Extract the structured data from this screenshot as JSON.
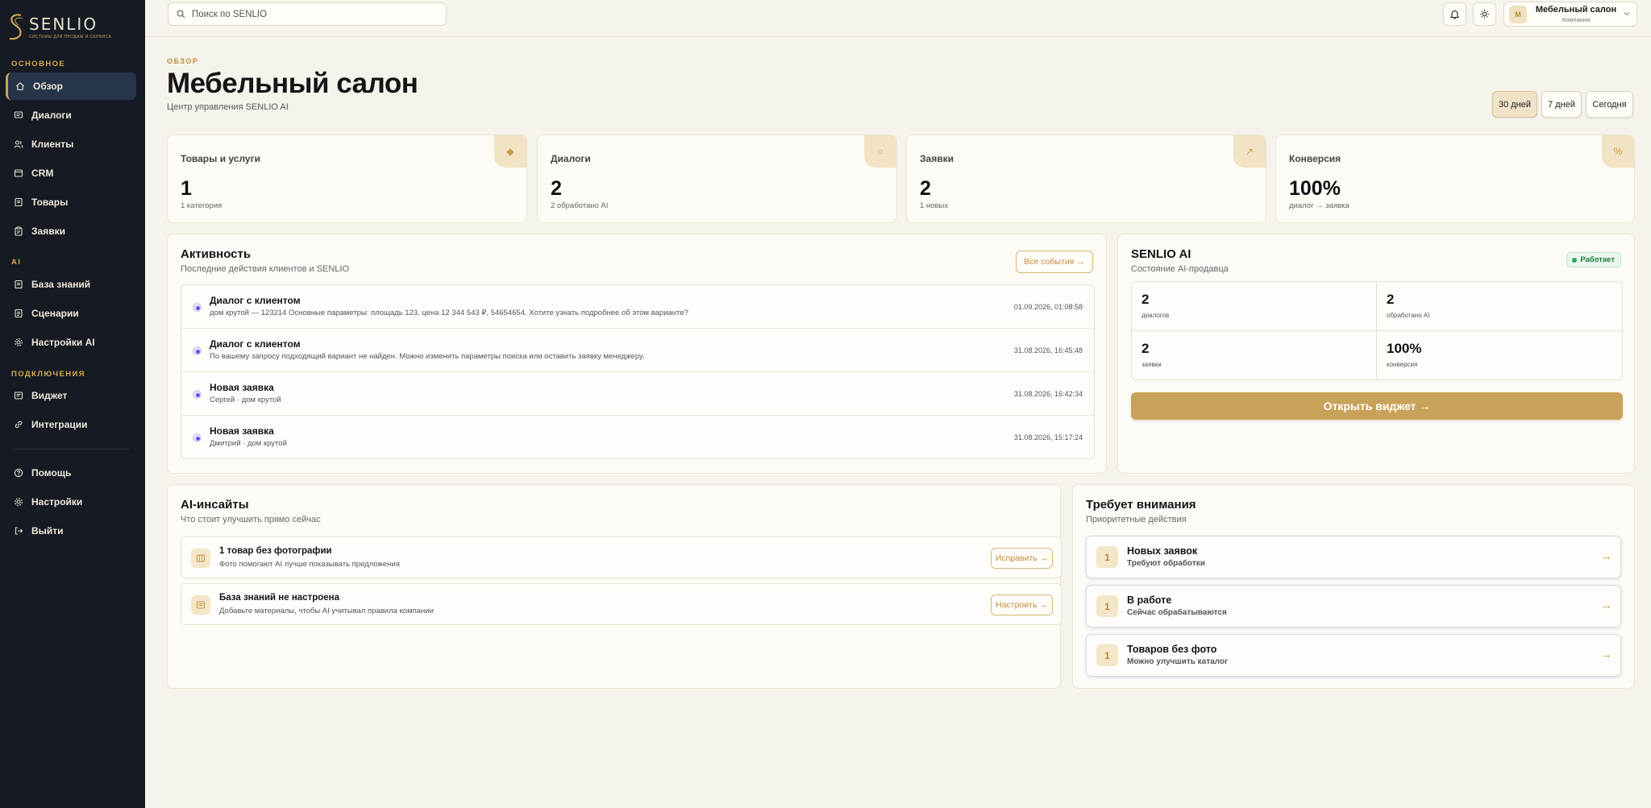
{
  "brand": {
    "name": "SENLIO",
    "tagline": "СИСТЕМЫ ДЛЯ ПРОДАЖ И СЕРВИСА"
  },
  "sidebar": {
    "sections": [
      {
        "title": "ОСНОВНОЕ",
        "items": [
          {
            "label": "Обзор",
            "icon": "home-icon",
            "active": true
          },
          {
            "label": "Диалоги",
            "icon": "chat-icon"
          },
          {
            "label": "Клиенты",
            "icon": "users-icon"
          },
          {
            "label": "CRM",
            "icon": "crm-icon"
          },
          {
            "label": "Товары",
            "icon": "box-icon"
          },
          {
            "label": "Заявки",
            "icon": "clipboard-icon"
          }
        ]
      },
      {
        "title": "AI",
        "items": [
          {
            "label": "База знаний",
            "icon": "book-icon"
          },
          {
            "label": "Сценарии",
            "icon": "script-icon"
          },
          {
            "label": "Настройки AI",
            "icon": "gear-icon"
          }
        ]
      },
      {
        "title": "ПОДКЛЮЧЕНИЯ",
        "items": [
          {
            "label": "Виджет",
            "icon": "widget-icon"
          },
          {
            "label": "Интеграции",
            "icon": "link-icon"
          }
        ]
      }
    ],
    "footer": [
      {
        "label": "Помощь",
        "icon": "help-icon"
      },
      {
        "label": "Настройки",
        "icon": "gear-icon"
      },
      {
        "label": "Выйти",
        "icon": "logout-icon"
      }
    ]
  },
  "topbar": {
    "search_placeholder": "Поиск по SENLIO",
    "company": {
      "initial": "М",
      "name": "Мебельный салон",
      "role": "Компания"
    }
  },
  "header": {
    "eyebrow": "ОБЗОР",
    "title": "Мебельный салон",
    "subtitle": "Центр управления SENLIO AI",
    "ranges": [
      {
        "label": "30 дней",
        "active": true
      },
      {
        "label": "7 дней"
      },
      {
        "label": "Сегодня"
      }
    ]
  },
  "stats": [
    {
      "label": "Товары и услуги",
      "value": "1",
      "sub": "1 категория",
      "icon": "◆"
    },
    {
      "label": "Диалоги",
      "value": "2",
      "sub": "2 обработано AI",
      "icon": "○"
    },
    {
      "label": "Заявки",
      "value": "2",
      "sub": "1 новых",
      "icon": "↗"
    },
    {
      "label": "Конверсия",
      "value": "100%",
      "sub": "диалог → заявка",
      "icon": "%"
    }
  ],
  "activity": {
    "title": "Активность",
    "subtitle": "Последние действия клиентов и SENLIO",
    "all_button": "Все события →",
    "items": [
      {
        "title": "Диалог с клиентом",
        "desc": "дом крутой — 123214 Основные параметры: площадь 123, цена 12 344 543 ₽, 54654654. Хотите узнать подробнее об этом варианте?",
        "time": "01.09.2026, 01:08:58"
      },
      {
        "title": "Диалог с клиентом",
        "desc": "По вашему запросу подходящий вариант не найден. Можно изменить параметры поиска или оставить заявку менеджеру.",
        "time": "31.08.2026, 16:45:48"
      },
      {
        "title": "Новая заявка",
        "desc": "Сергей · дом крутой",
        "time": "31.08.2026, 16:42:34"
      },
      {
        "title": "Новая заявка",
        "desc": "Дмитрий · дом крутой",
        "time": "31.08.2026, 15:17:24"
      }
    ]
  },
  "ai": {
    "title": "SENLIO AI",
    "subtitle": "Состояние AI-продавца",
    "status": "Работает",
    "status_color": "#26a85a",
    "metrics": [
      {
        "value": "2",
        "label": "диалогов"
      },
      {
        "value": "2",
        "label": "обработано AI"
      },
      {
        "value": "2",
        "label": "заявки"
      },
      {
        "value": "100%",
        "label": "конверсия"
      }
    ],
    "open_button": "Открыть виджет →"
  },
  "insights": {
    "title": "AI-инсайты",
    "subtitle": "Что стоит улучшить прямо сейчас",
    "items": [
      {
        "title": "1 товар без фотографии",
        "desc": "Фото помогают AI лучше показывать предложения",
        "button": "Исправить →",
        "icon": "image-icon"
      },
      {
        "title": "База знаний не настроена",
        "desc": "Добавьте материалы, чтобы AI учитывал правила компании",
        "button": "Настроить →",
        "icon": "book-icon"
      }
    ]
  },
  "attention": {
    "title": "Требует внимания",
    "subtitle": "Приоритетные действия",
    "items": [
      {
        "num": "1",
        "title": "Новых заявок",
        "desc": "Требуют обработки"
      },
      {
        "num": "1",
        "title": "В работе",
        "desc": "Сейчас обрабатываются"
      },
      {
        "num": "1",
        "title": "Товаров без фото",
        "desc": "Можно улучшить каталог"
      }
    ],
    "arrow": "→"
  },
  "colors": {
    "accent": "#c9a25a",
    "sidebar": "#161a22",
    "background": "#f6f3ec"
  }
}
